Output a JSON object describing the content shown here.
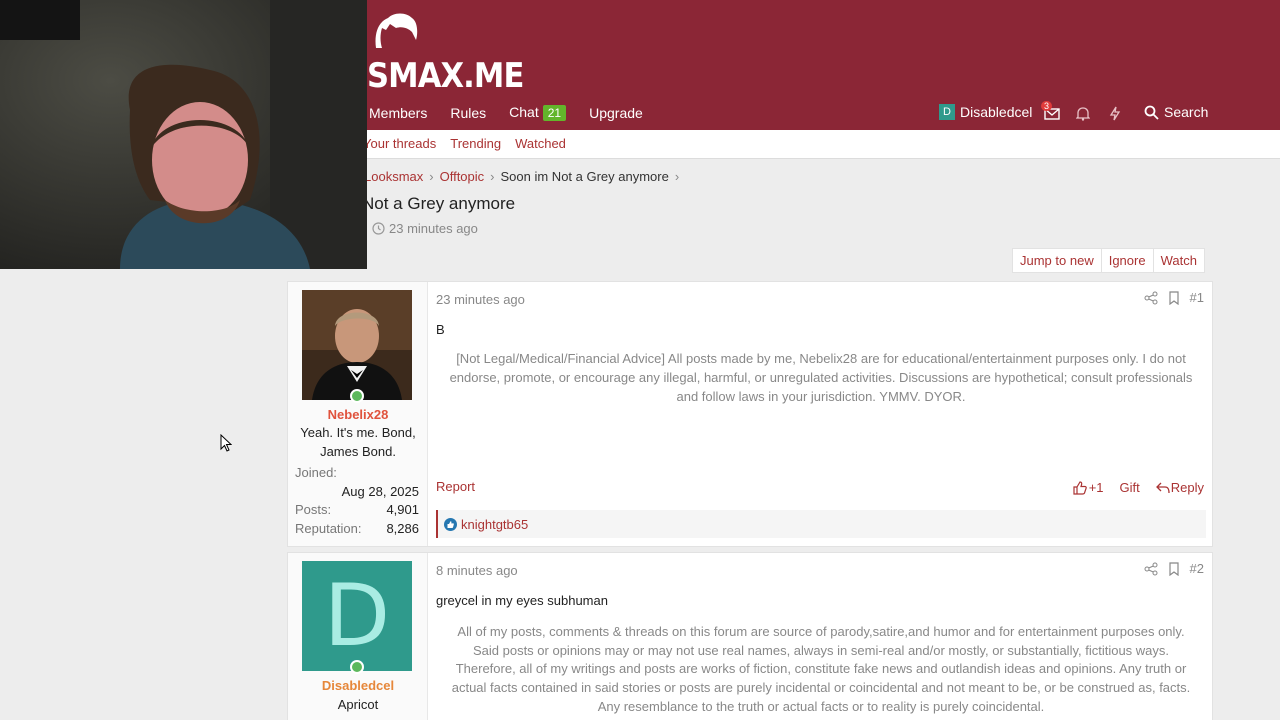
{
  "site": {
    "logo": "SMAX.ME"
  },
  "nav": {
    "members": "Members",
    "rules": "Rules",
    "chat": "Chat",
    "chat_count": "21",
    "upgrade": "Upgrade"
  },
  "user": {
    "avatar_letter": "D",
    "name": "Disabledcel",
    "inbox_badge": "3",
    "search": "Search"
  },
  "subnav": {
    "your_threads": "Your threads",
    "trending": "Trending",
    "watched": "Watched"
  },
  "breadcrumb": {
    "forum": "Looksmax",
    "category": "Offtopic",
    "thread": "Soon im Not a Grey anymore"
  },
  "thread": {
    "title": "Not a Grey anymore",
    "time": "23 minutes ago"
  },
  "actions": {
    "jump": "Jump to new",
    "ignore": "Ignore",
    "watch": "Watch"
  },
  "posts": [
    {
      "author": "Nebelix28",
      "user_title_1": "Yeah. It's me. Bond,",
      "user_title_2": "James Bond.",
      "joined_label": "Joined:",
      "joined": "Aug 28, 2025",
      "posts_label": "Posts:",
      "posts": "4,901",
      "rep_label": "Reputation:",
      "rep": "8,286",
      "date": "23 minutes ago",
      "num": "#1",
      "body": "B",
      "sig_1": "[Not Legal/Medical/Financial Advice] All posts made by me, Nebelix28 are for educational/entertainment purposes only. I do not",
      "sig_2": "endorse, promote, or encourage any illegal, harmful, or unregulated activities. Discussions are hypothetical; consult professionals",
      "sig_3": "and follow laws in your jurisdiction. YMMV. DYOR.",
      "report": "Report",
      "like": "+1",
      "gift": "Gift",
      "reply": "Reply",
      "reacted_by": "knightgtb65"
    },
    {
      "author": "Disabledcel",
      "avatar_letter": "D",
      "user_title_1": "Apricot",
      "date": "8 minutes ago",
      "num": "#2",
      "body": "greycel in my eyes subhuman",
      "sig_1": "All of my posts, comments & threads on this forum are source of parody,satire,and humor and for entertainment purposes only.",
      "sig_2": "Said posts or opinions may or may not use real names, always in semi-real and/or mostly, or substantially, fictitious ways.",
      "sig_3": "Therefore, all of my writings and posts are works of fiction, constitute fake news and outlandish ideas and opinions. Any truth or",
      "sig_4": "actual facts contained in said stories or posts are purely incidental or coincidental and not meant to be, or be construed as, facts.",
      "sig_5": "Any resemblance to the truth or actual facts or to reality is purely coincidental."
    }
  ],
  "colors": {
    "header": "#8b2636",
    "accent": "#aa3333",
    "online": "#5cb85c",
    "avatar_teal": "#2f9a8c"
  }
}
